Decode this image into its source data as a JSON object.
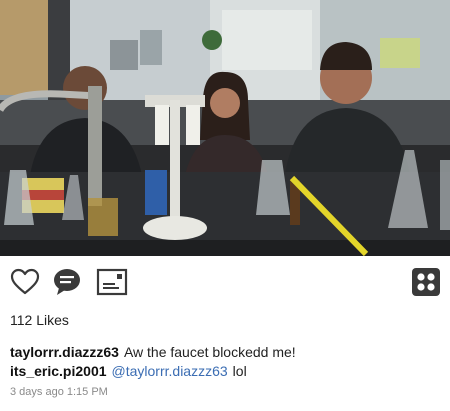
{
  "post": {
    "likes_text": "112 Likes",
    "timestamp": "3 days ago 1:15 PM"
  },
  "actions": {
    "like_icon": "heart-outline-icon",
    "comment_icon": "speech-bubble-icon",
    "share_icon": "post-card-icon",
    "menu_icon": "four-dots-grid-icon"
  },
  "comments": [
    {
      "user": "taylorrr.diazzz63",
      "mention": "",
      "text": "Aw the faucet blockedd me!"
    },
    {
      "user": "its_eric.pi2001",
      "mention": "@taylorrr.diazzz63",
      "text": "lol"
    }
  ],
  "colors": {
    "mention": "#3b6db3",
    "timestamp": "#8a8a8a",
    "icon": "#3a3a3a"
  }
}
